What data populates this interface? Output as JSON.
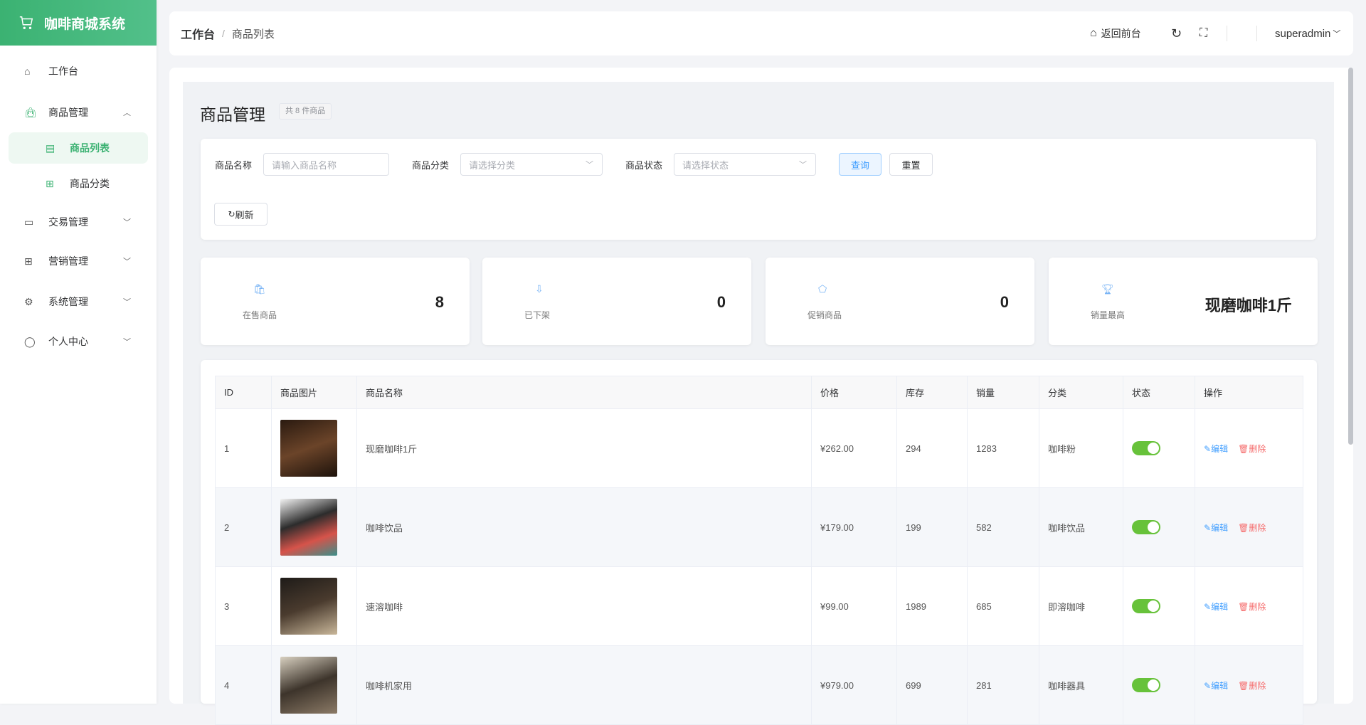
{
  "app": {
    "title": "咖啡商城系统"
  },
  "sidebar": {
    "items": [
      {
        "label": "工作台",
        "icon": "home-icon"
      },
      {
        "label": "商品管理",
        "icon": "bag-icon"
      },
      {
        "label": "商品列表",
        "icon": "list-icon"
      },
      {
        "label": "商品分类",
        "icon": "gift-icon"
      },
      {
        "label": "交易管理",
        "icon": "card-icon"
      },
      {
        "label": "营销管理",
        "icon": "gift-icon"
      },
      {
        "label": "系统管理",
        "icon": "gear-icon"
      },
      {
        "label": "个人中心",
        "icon": "user-icon"
      }
    ]
  },
  "header": {
    "breadcrumb": [
      "工作台",
      "商品列表"
    ],
    "back_label": "返回前台",
    "user": "superadmin"
  },
  "page": {
    "title": "商品管理",
    "count_badge": "共 8 件商品"
  },
  "filters": {
    "name_label": "商品名称",
    "name_placeholder": "请输入商品名称",
    "category_label": "商品分类",
    "category_placeholder": "请选择分类",
    "status_label": "商品状态",
    "status_placeholder": "请选择状态",
    "search": "查询",
    "reset": "重置",
    "refresh": "刷新"
  },
  "stats": [
    {
      "label": "在售商品",
      "value": "8"
    },
    {
      "label": "已下架",
      "value": "0"
    },
    {
      "label": "促销商品",
      "value": "0"
    },
    {
      "label": "销量最高",
      "value": "现磨咖啡1斤"
    }
  ],
  "table": {
    "headers": [
      "ID",
      "商品图片",
      "商品名称",
      "价格",
      "库存",
      "销量",
      "分类",
      "状态",
      "操作"
    ],
    "edit": "编辑",
    "delete": "删除",
    "rows": [
      {
        "id": "1",
        "name": "现磨咖啡1斤",
        "price": "¥262.00",
        "stock": "294",
        "sales": "1283",
        "category": "咖啡粉",
        "status": true
      },
      {
        "id": "2",
        "name": "咖啡饮品",
        "price": "¥179.00",
        "stock": "199",
        "sales": "582",
        "category": "咖啡饮品",
        "status": true
      },
      {
        "id": "3",
        "name": "速溶咖啡",
        "price": "¥99.00",
        "stock": "1989",
        "sales": "685",
        "category": "即溶咖啡",
        "status": true
      },
      {
        "id": "4",
        "name": "咖啡机家用",
        "price": "¥979.00",
        "stock": "699",
        "sales": "281",
        "category": "咖啡器具",
        "status": true
      }
    ]
  },
  "colors": {
    "brand": "#3bb272",
    "primary": "#409eff",
    "danger": "#f56c6c",
    "switch": "#67c23a"
  }
}
